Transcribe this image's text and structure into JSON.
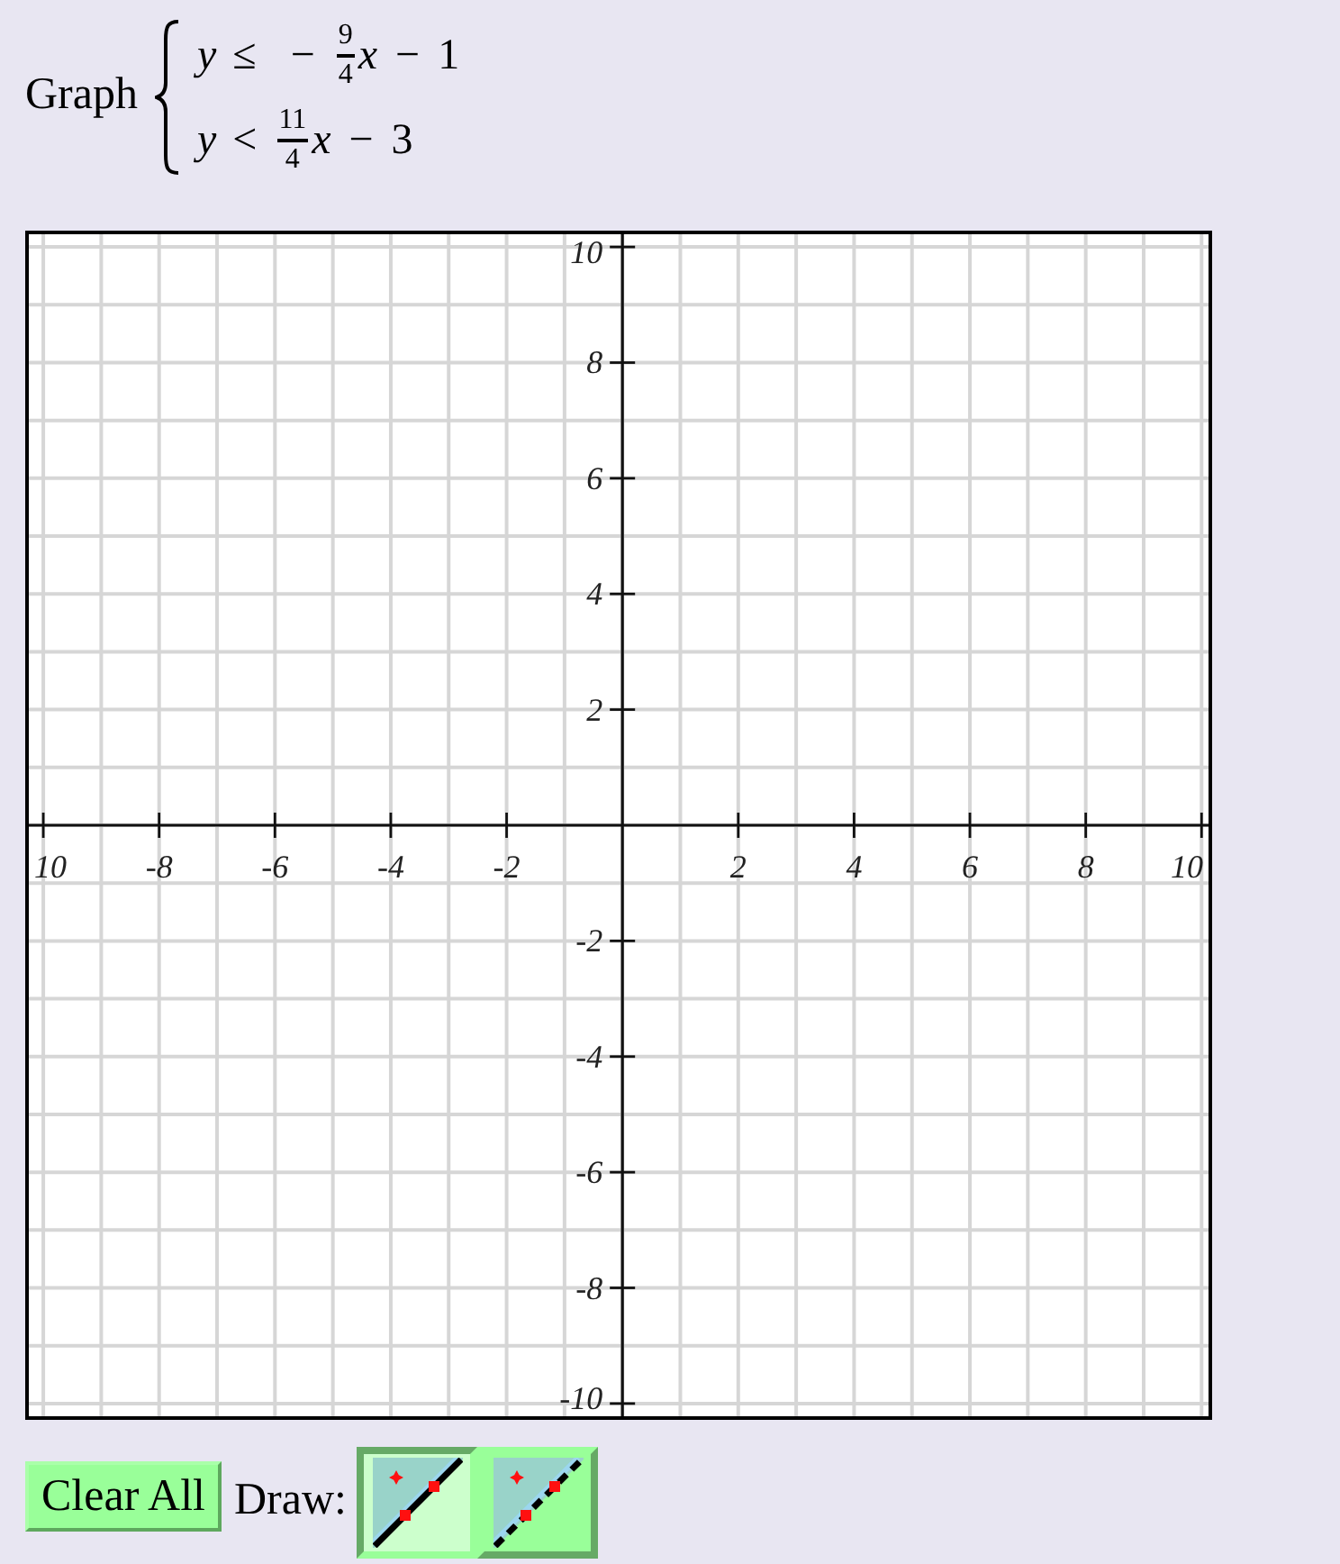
{
  "system": {
    "label": "Graph",
    "inequalities": [
      {
        "terms": [
          {
            "kind": "var",
            "text": "y"
          },
          {
            "kind": "rel",
            "text": "≤"
          },
          {
            "kind": "op",
            "text": "−"
          },
          {
            "kind": "frac",
            "numerator": "9",
            "denominator": "4"
          },
          {
            "kind": "var",
            "text": "x"
          },
          {
            "kind": "op",
            "text": "−"
          },
          {
            "kind": "num",
            "text": "1"
          }
        ]
      },
      {
        "terms": [
          {
            "kind": "var",
            "text": "y"
          },
          {
            "kind": "rel",
            "text": "<"
          },
          {
            "kind": "frac",
            "numerator": "11",
            "denominator": "4"
          },
          {
            "kind": "var",
            "text": "x"
          },
          {
            "kind": "op",
            "text": "−"
          },
          {
            "kind": "num",
            "text": "3"
          }
        ]
      }
    ]
  },
  "graph": {
    "chart_data": {
      "type": "scatter",
      "xlim": [
        -10.25,
        10.12
      ],
      "ylim": [
        -10.22,
        10.22
      ],
      "grid": true,
      "xticks": [
        {
          "value": -10,
          "label": "10"
        },
        -8,
        -6,
        -4,
        -2,
        2,
        4,
        6,
        8,
        10
      ],
      "yticks": [
        10,
        8,
        6,
        4,
        2,
        -2,
        -4,
        -6,
        -8,
        -10
      ]
    }
  },
  "controls": {
    "clear_button": "Clear All",
    "draw_label": "Draw:",
    "draw_tools": [
      {
        "kind": "solid",
        "selected": true
      },
      {
        "kind": "dashed",
        "selected": false
      }
    ]
  }
}
